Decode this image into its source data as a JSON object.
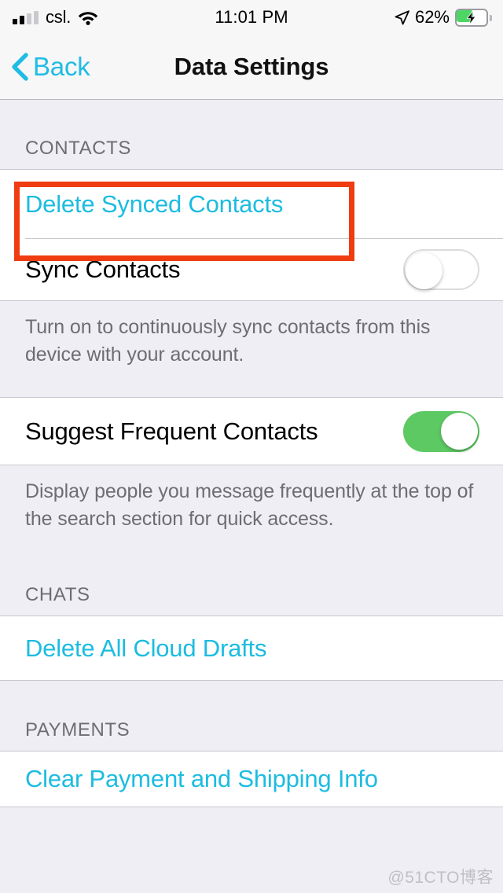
{
  "status_bar": {
    "carrier": "csl.",
    "time": "11:01 PM",
    "battery_percent": "62%",
    "signal_bars_filled": 2,
    "signal_bars_total": 4,
    "wifi_icon": "wifi-icon",
    "location_icon": "location-arrow-icon",
    "battery_icon": "battery-charging-icon",
    "battery_fill_color": "#4CD764",
    "charging": true
  },
  "nav": {
    "back_label": "Back",
    "back_icon": "chevron-left-icon",
    "title": "Data Settings",
    "tint_color": "#20BCE4"
  },
  "sections": [
    {
      "header": "CONTACTS",
      "rows": [
        {
          "label": "Delete Synced Contacts",
          "type": "link"
        },
        {
          "label": "Sync Contacts",
          "type": "toggle",
          "value": "off"
        }
      ],
      "footer": "Turn on to continuously sync contacts from this device with your account."
    },
    {
      "header": "",
      "rows": [
        {
          "label": "Suggest Frequent Contacts",
          "type": "toggle",
          "value": "on"
        }
      ],
      "footer": "Display people you message frequently at the top of the search section for quick access."
    },
    {
      "header": "CHATS",
      "rows": [
        {
          "label": "Delete All Cloud Drafts",
          "type": "link"
        }
      ],
      "footer": ""
    },
    {
      "header": "PAYMENTS",
      "rows": [
        {
          "label": "Clear Payment and Shipping Info",
          "type": "link"
        }
      ],
      "footer": ""
    }
  ],
  "annotation": {
    "target": "Delete Synced Contacts",
    "color": "#EF3C11"
  },
  "watermark": "@51CTO博客",
  "colors": {
    "link": "#1CBCE0",
    "toggle_on": "#5DC963",
    "background": "#EFEEF4",
    "row_background": "#FFFFFF",
    "secondary_text": "#6D6D72"
  }
}
